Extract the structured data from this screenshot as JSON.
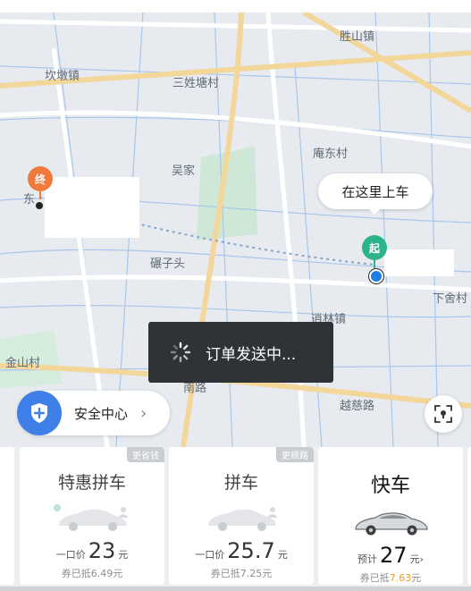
{
  "map": {
    "labels": {
      "shengshan": "胜山镇",
      "kandun": "坎墩镇",
      "sanxingtang": "三姓塘村",
      "andong": "庵东村",
      "wujia": "吴家",
      "dong": "东",
      "jianzitou": "碾子头",
      "xiashe": "下舍村",
      "xiaolin": "逍林镇",
      "jinshan": "金山村",
      "nanlu": "南路",
      "yuecilu": "越慈路"
    },
    "pickup_callout": "在这里上车",
    "pin_end": "终",
    "pin_start": "起"
  },
  "toast": {
    "text": "订单发送中..."
  },
  "safety": {
    "label": "安全中心",
    "chevron": "›"
  },
  "options": [
    {
      "tag": "更省钱",
      "name": "特惠拼车",
      "price_prefix": "一口价",
      "price": "23",
      "unit": "元",
      "coupon_prefix": "券已抵",
      "coupon_value": "6.49元"
    },
    {
      "tag": "更顺路",
      "name": "拼车",
      "price_prefix": "一口价",
      "price": "25.7",
      "unit": "元",
      "coupon_prefix": "券已抵",
      "coupon_value": "7.25元"
    },
    {
      "name": "快车",
      "price_prefix": "预计",
      "price": "27",
      "unit": "元›",
      "coupon_prefix": "券已抵",
      "coupon_value": "7.63",
      "coupon_suffix": "元"
    }
  ],
  "colors": {
    "accent_blue": "#3f7fe8",
    "start_green": "#2bb38c",
    "end_orange": "#f07a3c",
    "coupon_orange": "#f39c1f"
  }
}
